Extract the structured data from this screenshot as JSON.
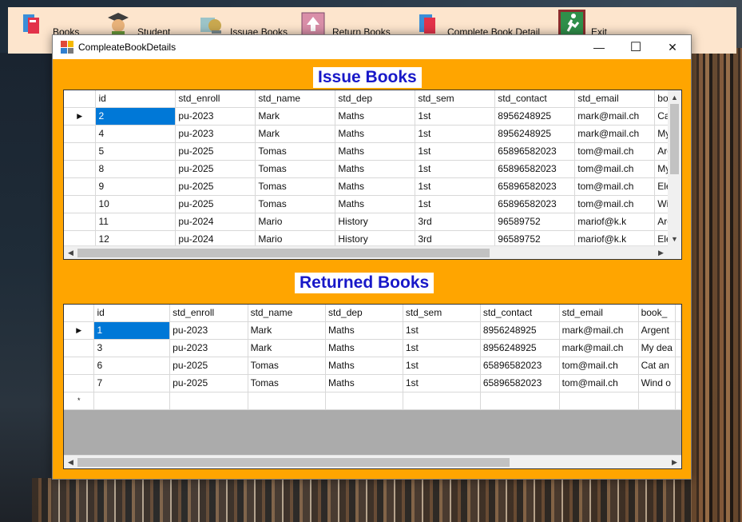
{
  "menu": {
    "items": [
      {
        "label": "Books",
        "icon": "books-icon"
      },
      {
        "label": "Student",
        "icon": "student-icon"
      },
      {
        "label": "Issuae Books",
        "icon": "issue-books-icon"
      },
      {
        "label": "Return Books",
        "icon": "return-books-icon"
      },
      {
        "label": "Complete Book Detail",
        "icon": "complete-detail-icon"
      },
      {
        "label": "Exit",
        "icon": "exit-icon"
      }
    ]
  },
  "window": {
    "title": "CompleateBookDetails",
    "accent": "#ffa500"
  },
  "issue": {
    "title": "Issue Books",
    "columns": [
      "id",
      "std_enroll",
      "std_name",
      "std_dep",
      "std_sem",
      "std_contact",
      "std_email",
      "bo"
    ],
    "rows": [
      [
        "2",
        "pu-2023",
        "Mark",
        "Maths",
        "1st",
        "8956248925",
        "mark@mail.ch",
        "Ca"
      ],
      [
        "4",
        "pu-2023",
        "Mark",
        "Maths",
        "1st",
        "8956248925",
        "mark@mail.ch",
        "My"
      ],
      [
        "5",
        "pu-2025",
        "Tomas",
        "Maths",
        "1st",
        "65896582023",
        "tom@mail.ch",
        "Arg"
      ],
      [
        "8",
        "pu-2025",
        "Tomas",
        "Maths",
        "1st",
        "65896582023",
        "tom@mail.ch",
        "My"
      ],
      [
        "9",
        "pu-2025",
        "Tomas",
        "Maths",
        "1st",
        "65896582023",
        "tom@mail.ch",
        "Ele"
      ],
      [
        "10",
        "pu-2025",
        "Tomas",
        "Maths",
        "1st",
        "65896582023",
        "tom@mail.ch",
        "Wi"
      ],
      [
        "11",
        "pu-2024",
        "Mario",
        "History",
        "3rd",
        "96589752",
        "mariof@k.k",
        "Arg"
      ],
      [
        "12",
        "pu-2024",
        "Mario",
        "History",
        "3rd",
        "96589752",
        "mariof@k.k",
        "Ele"
      ]
    ]
  },
  "returned": {
    "title": "Returned Books",
    "columns": [
      "id",
      "std_enroll",
      "std_name",
      "std_dep",
      "std_sem",
      "std_contact",
      "std_email",
      "book_"
    ],
    "rows": [
      [
        "1",
        "pu-2023",
        "Mark",
        "Maths",
        "1st",
        "8956248925",
        "mark@mail.ch",
        "Argent"
      ],
      [
        "3",
        "pu-2023",
        "Mark",
        "Maths",
        "1st",
        "8956248925",
        "mark@mail.ch",
        "My dea"
      ],
      [
        "6",
        "pu-2025",
        "Tomas",
        "Maths",
        "1st",
        "65896582023",
        "tom@mail.ch",
        "Cat an"
      ],
      [
        "7",
        "pu-2025",
        "Tomas",
        "Maths",
        "1st",
        "65896582023",
        "tom@mail.ch",
        "Wind o"
      ]
    ],
    "new_row_marker": "*"
  },
  "glyphs": {
    "current_row": "▶",
    "minimize": "—",
    "maximize": "☐",
    "close": "✕",
    "arrow_left": "◀",
    "arrow_right": "▶",
    "arrow_up": "▲",
    "arrow_down": "▼"
  }
}
